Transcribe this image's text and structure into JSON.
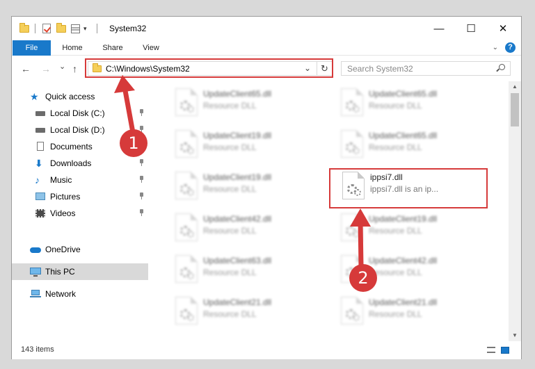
{
  "window": {
    "title": "System32",
    "controls": {
      "minimize": "—",
      "maximize": "☐",
      "close": "✕"
    }
  },
  "ribbon": {
    "tabs": [
      "File",
      "Home",
      "Share",
      "View"
    ],
    "help": "?"
  },
  "navigation": {
    "back": "←",
    "forward": "→",
    "recent": "⌄",
    "up": "↑",
    "address": "C:\\Windows\\System32",
    "search_placeholder": "Search System32"
  },
  "sidebar": {
    "items": [
      {
        "label": "Quick access",
        "icon": "star-icon",
        "pinned": false
      },
      {
        "label": "Local Disk (C:)",
        "icon": "drive-icon",
        "pinned": true
      },
      {
        "label": "Local Disk (D:)",
        "icon": "drive-icon",
        "pinned": true
      },
      {
        "label": "Documents",
        "icon": "documents-icon",
        "pinned": true
      },
      {
        "label": "Downloads",
        "icon": "download-icon",
        "pinned": true
      },
      {
        "label": "Music",
        "icon": "music-icon",
        "pinned": true
      },
      {
        "label": "Pictures",
        "icon": "pictures-icon",
        "pinned": true
      },
      {
        "label": "Videos",
        "icon": "videos-icon",
        "pinned": true
      },
      {
        "label": "OneDrive",
        "icon": "cloud-icon",
        "pinned": false
      },
      {
        "label": "This PC",
        "icon": "computer-icon",
        "pinned": false,
        "selected": true
      },
      {
        "label": "Network",
        "icon": "network-icon",
        "pinned": false
      }
    ]
  },
  "files": {
    "left": [
      {
        "name": "UpdateClient65.dll",
        "desc": "Resource DLL"
      },
      {
        "name": "UpdateClient19.dll",
        "desc": "Resource DLL"
      },
      {
        "name": "UpdateClient19.dll",
        "desc": "Resource DLL"
      },
      {
        "name": "UpdateClient42.dll",
        "desc": "Resource DLL"
      },
      {
        "name": "UpdateClient63.dll",
        "desc": "Resource DLL"
      },
      {
        "name": "UpdateClient21.dll",
        "desc": "Resource DLL"
      }
    ],
    "right": [
      {
        "name": "UpdateClient65.dll",
        "desc": "Resource DLL"
      },
      {
        "name": "UpdateClient65.dll",
        "desc": "Resource DLL"
      },
      {
        "name": "ippsi7.dll",
        "desc": "ippsi7.dll is an ip...",
        "highlighted": true
      },
      {
        "name": "UpdateClient19.dll",
        "desc": "Resource DLL"
      },
      {
        "name": "UpdateClient42.dll",
        "desc": "Resource DLL"
      },
      {
        "name": "UpdateClient21.dll",
        "desc": "Resource DLL"
      }
    ]
  },
  "status": {
    "item_count": "143 items"
  },
  "annotations": {
    "step1": "1",
    "step2": "2",
    "color": "#d63a3a"
  }
}
